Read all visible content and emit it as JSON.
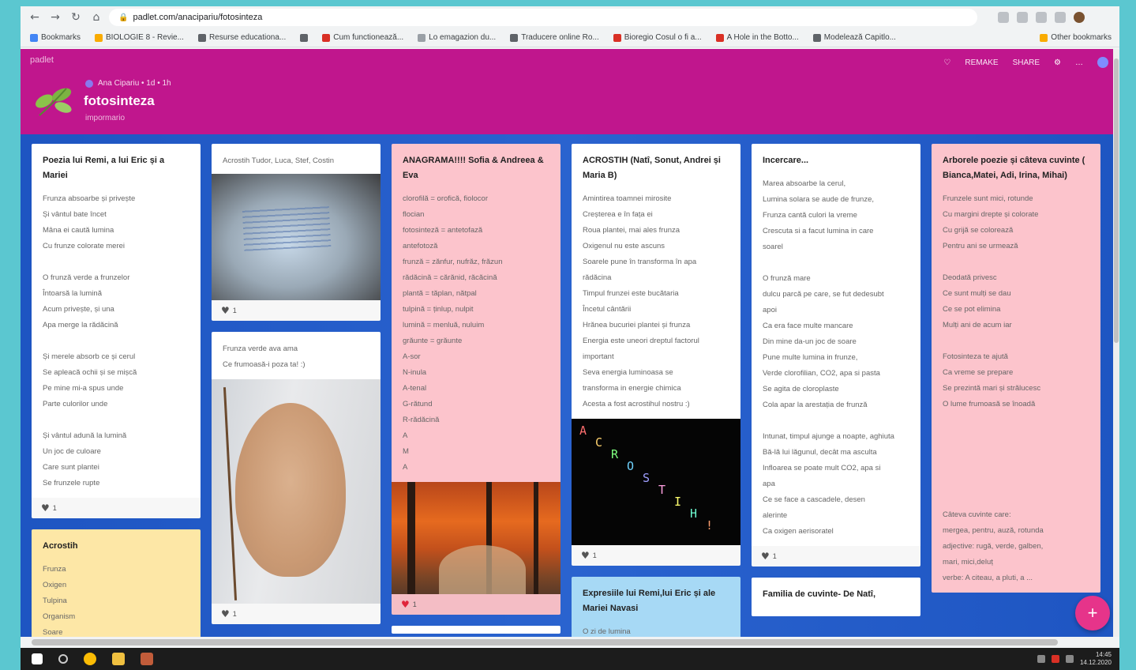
{
  "browser": {
    "url": "padlet.com/anacipariu/fotosinteza",
    "bookmarks": [
      {
        "label": "Bookmarks",
        "color": "#4285f4"
      },
      {
        "label": "BIOLOGIE 8 - Revie...",
        "color": "#f9ab00"
      },
      {
        "label": "Resurse educationa...",
        "color": "#5f6368"
      },
      {
        "label": "",
        "color": "#5f6368"
      },
      {
        "label": "Cum functionează...",
        "color": "#d93025"
      },
      {
        "label": "Lo emagazion du...",
        "color": "#9aa0a6"
      },
      {
        "label": "Traducere online Ro...",
        "color": "#5f6368"
      },
      {
        "label": "Bioregio Cosul o fi a...",
        "color": "#d93025"
      },
      {
        "label": "A Hole in the Botto...",
        "color": "#d93025"
      },
      {
        "label": "Modelează Capitlo...",
        "color": "#5f6368"
      }
    ],
    "other_bookmarks": "Other bookmarks"
  },
  "padlet": {
    "brand": "padlet",
    "author_meta": "Ana Cipariu  •  1d  •  1h",
    "title": "fotosinteza",
    "subtitle": "impormario",
    "header_actions": {
      "remake": "REMAKE",
      "share": "SHARE"
    },
    "accent": "#c0168d"
  },
  "columns": [
    {
      "cards": [
        {
          "color": "white",
          "title": "Poezia lui Remi, a lui Eric și a Mariei",
          "lines": [
            "Frunza absoarbe și privește",
            "Și vântul bate încet",
            "Mâna ei caută lumina",
            "Cu frunze colorate merei",
            "",
            "O frunză verde a frunzelor",
            "Întoarsă la lumină",
            "Acum privește, și una",
            "Apa merge la rădăcină",
            "",
            "Și merele absorb ce și cerul",
            "Se apleacă ochii și se mișcă",
            "Pe mine mi-a spus unde",
            "Parte culorilor unde",
            "",
            "Și vântul adună la lumină",
            "Un joc de culoare",
            "Care sunt plantei",
            "Se frunzele rupte"
          ],
          "likes": "1",
          "heart": "grey"
        },
        {
          "color": "yellow",
          "title": "Acrostih",
          "lines": [
            "Frunza",
            "Oxigen",
            "Tulpina",
            "Organism",
            "Soare"
          ]
        }
      ]
    },
    {
      "cards": [
        {
          "color": "white",
          "caption": "Acrostih Tudor, Luca, Stef, Costin",
          "image": "photo1",
          "likes": "1",
          "heart": "grey"
        },
        {
          "color": "white",
          "lines": [
            "Frunza verde ava ama",
            "Ce frumoasă-i poza ta! :)"
          ],
          "image": "photo2",
          "likes": "1",
          "heart": "grey"
        }
      ]
    },
    {
      "cards": [
        {
          "color": "pink",
          "title": "ANAGRAMA!!!! Sofia & Andreea & Eva",
          "lines": [
            "clorofilă = orofică, fiolocor",
            "flocian",
            "fotosinteză = antetofază",
            "antefotoză",
            "frunză = zănfur, nufrăz, frăzun",
            "rădăcină = cărănid, răcăcină",
            "plantă = tăplan, nătpal",
            "tulpină = ținlup, nulpit",
            "lumină = menluă, nuluim",
            "grăunte = grăunte",
            "A-sor",
            "N-inula",
            "A-tenal",
            "G-rătund",
            "R-rădăcină",
            "A",
            "M",
            "A"
          ],
          "image": "photo3",
          "likes": "1",
          "heart": "red"
        },
        {
          "color": "white",
          "stub": true
        }
      ]
    },
    {
      "cards": [
        {
          "color": "white",
          "title": "ACROSTIH (Natî, Sonut, Andrei și Maria B)",
          "lines": [
            "Amintirea toamnei mirosite",
            "Creșterea e în fața ei",
            "Roua plantei, mai ales frunza",
            "Oxigenul nu este ascuns",
            "Soarele pune în transforma în apa",
            "rădăcina",
            "Timpul frunzei este bucătaria",
            "Încetul cântării",
            "Hrănea bucuriei plantei și frunza",
            "Energia este uneori dreptul factorul",
            "important",
            "Seva energia luminoasa se",
            "transforma in energie chimica",
            "Acesta a fost acrostihul nostru :)"
          ],
          "image": "photo4",
          "image_letters": [
            "A",
            "C",
            "R",
            "O",
            "S",
            "T",
            "I",
            "H",
            "!"
          ],
          "likes": "1",
          "heart": "grey"
        },
        {
          "color": "blue",
          "title": "Expresiile lui Remi,lui Eric și ale Mariei Navasi",
          "lines": [
            "O zi de lumina"
          ]
        }
      ]
    },
    {
      "cards": [
        {
          "color": "white",
          "title": "Incercare...",
          "lines": [
            "Marea absoarbe la cerul,",
            "Lumina solara se aude de frunze,",
            "Frunza cantă culori la vreme",
            "Crescuta si a facut lumina in care",
            "soarel",
            "",
            "O frunză mare",
            "dulcu parcă pe care, se fut dedesubt",
            "apoi",
            "Ca era face multe mancare",
            "Din mine da-un joc de soare",
            "Pune multe lumina in frunze,",
            "Verde clorofilian, CO2, apa si pasta",
            "Se agita de cloroplaste",
            "Cola apar la arestația de frunză",
            "",
            "Intunat, timpul ajunge a noapte, aghiuta",
            "Bă-lă lui lăgunul, decât ma asculta",
            "Infloarea se poate mult CO2, apa si",
            "apa",
            "Ce se face a cascadele, desen",
            "alerinte",
            "Ca oxigen aerisoratel"
          ],
          "likes": "1",
          "heart": "grey"
        },
        {
          "color": "white",
          "title": "Familia de cuvinte- De Natî,"
        }
      ]
    },
    {
      "cards": [
        {
          "color": "pink",
          "title": "Arborele poezie și câteva cuvinte ( Bianca,Matei, Adi, Irina, Mihai)",
          "lines": [
            "Frunzele sunt mici, rotunde",
            "Cu margini drepte și colorate",
            "Cu grijă se colorează",
            "Pentru ani se urmează",
            "",
            "Deodată privesc",
            "Ce sunt mulți se dau",
            "Ce se pot elimina",
            "Mulți ani de acum iar",
            "",
            "Fotosinteza te ajută",
            "Ca vreme se prepare",
            "Se prezintă mari și strălucesc",
            "O lume frumoasă se înoadă",
            "",
            "",
            "",
            "",
            "",
            "",
            "Câteva cuvinte care:",
            "mergea, pentru, auză, rotunda",
            "adjective: rugă, verde, galben,",
            "mari, mici,deluț",
            "verbe: A citeau, a pluti, a ..."
          ]
        }
      ]
    }
  ],
  "fab": "+",
  "taskbar": {
    "time": "14:45",
    "date": "14.12.2020"
  }
}
